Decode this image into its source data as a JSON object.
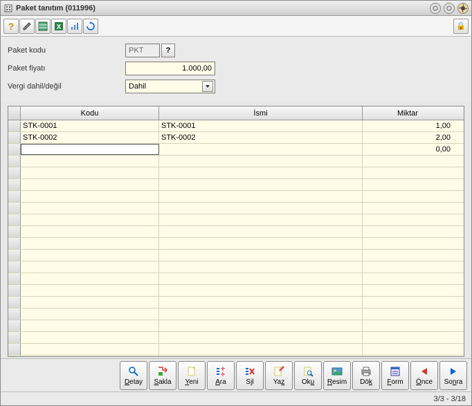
{
  "window": {
    "title": "Paket tanıtım (011996)"
  },
  "toolbar": {
    "help_icon": "?",
    "lock_icon": "🔒"
  },
  "form": {
    "paket_kodu_label": "Paket kodu",
    "paket_kodu_value": "PKT",
    "lookup_btn": "?",
    "paket_fiyati_label": "Paket fiyatı",
    "paket_fiyati_value": "1.000,00",
    "vergi_label": "Vergi dahil/değil",
    "vergi_value": "Dahil"
  },
  "grid": {
    "headers": {
      "kodu": "Kodu",
      "ismi": "İsmi",
      "miktar": "Miktar"
    },
    "rows": [
      {
        "kodu": "STK-0001",
        "ismi": "STK-0001",
        "miktar": "1,00"
      },
      {
        "kodu": "STK-0002",
        "ismi": "STK-0002",
        "miktar": "2,00"
      },
      {
        "kodu": "",
        "ismi": "",
        "miktar": "0,00"
      }
    ]
  },
  "actions": {
    "detay": "Detay",
    "sakla": "Sakla",
    "yeni": "Yeni",
    "ara": "Ara",
    "sil": "Sil",
    "yaz": "Yaz",
    "oku": "Oku",
    "resim": "Resim",
    "dok": "Dök",
    "form": "Form",
    "once": "Önce",
    "sonra": "Sonra"
  },
  "status": {
    "text": "3/3 - 3/18"
  }
}
